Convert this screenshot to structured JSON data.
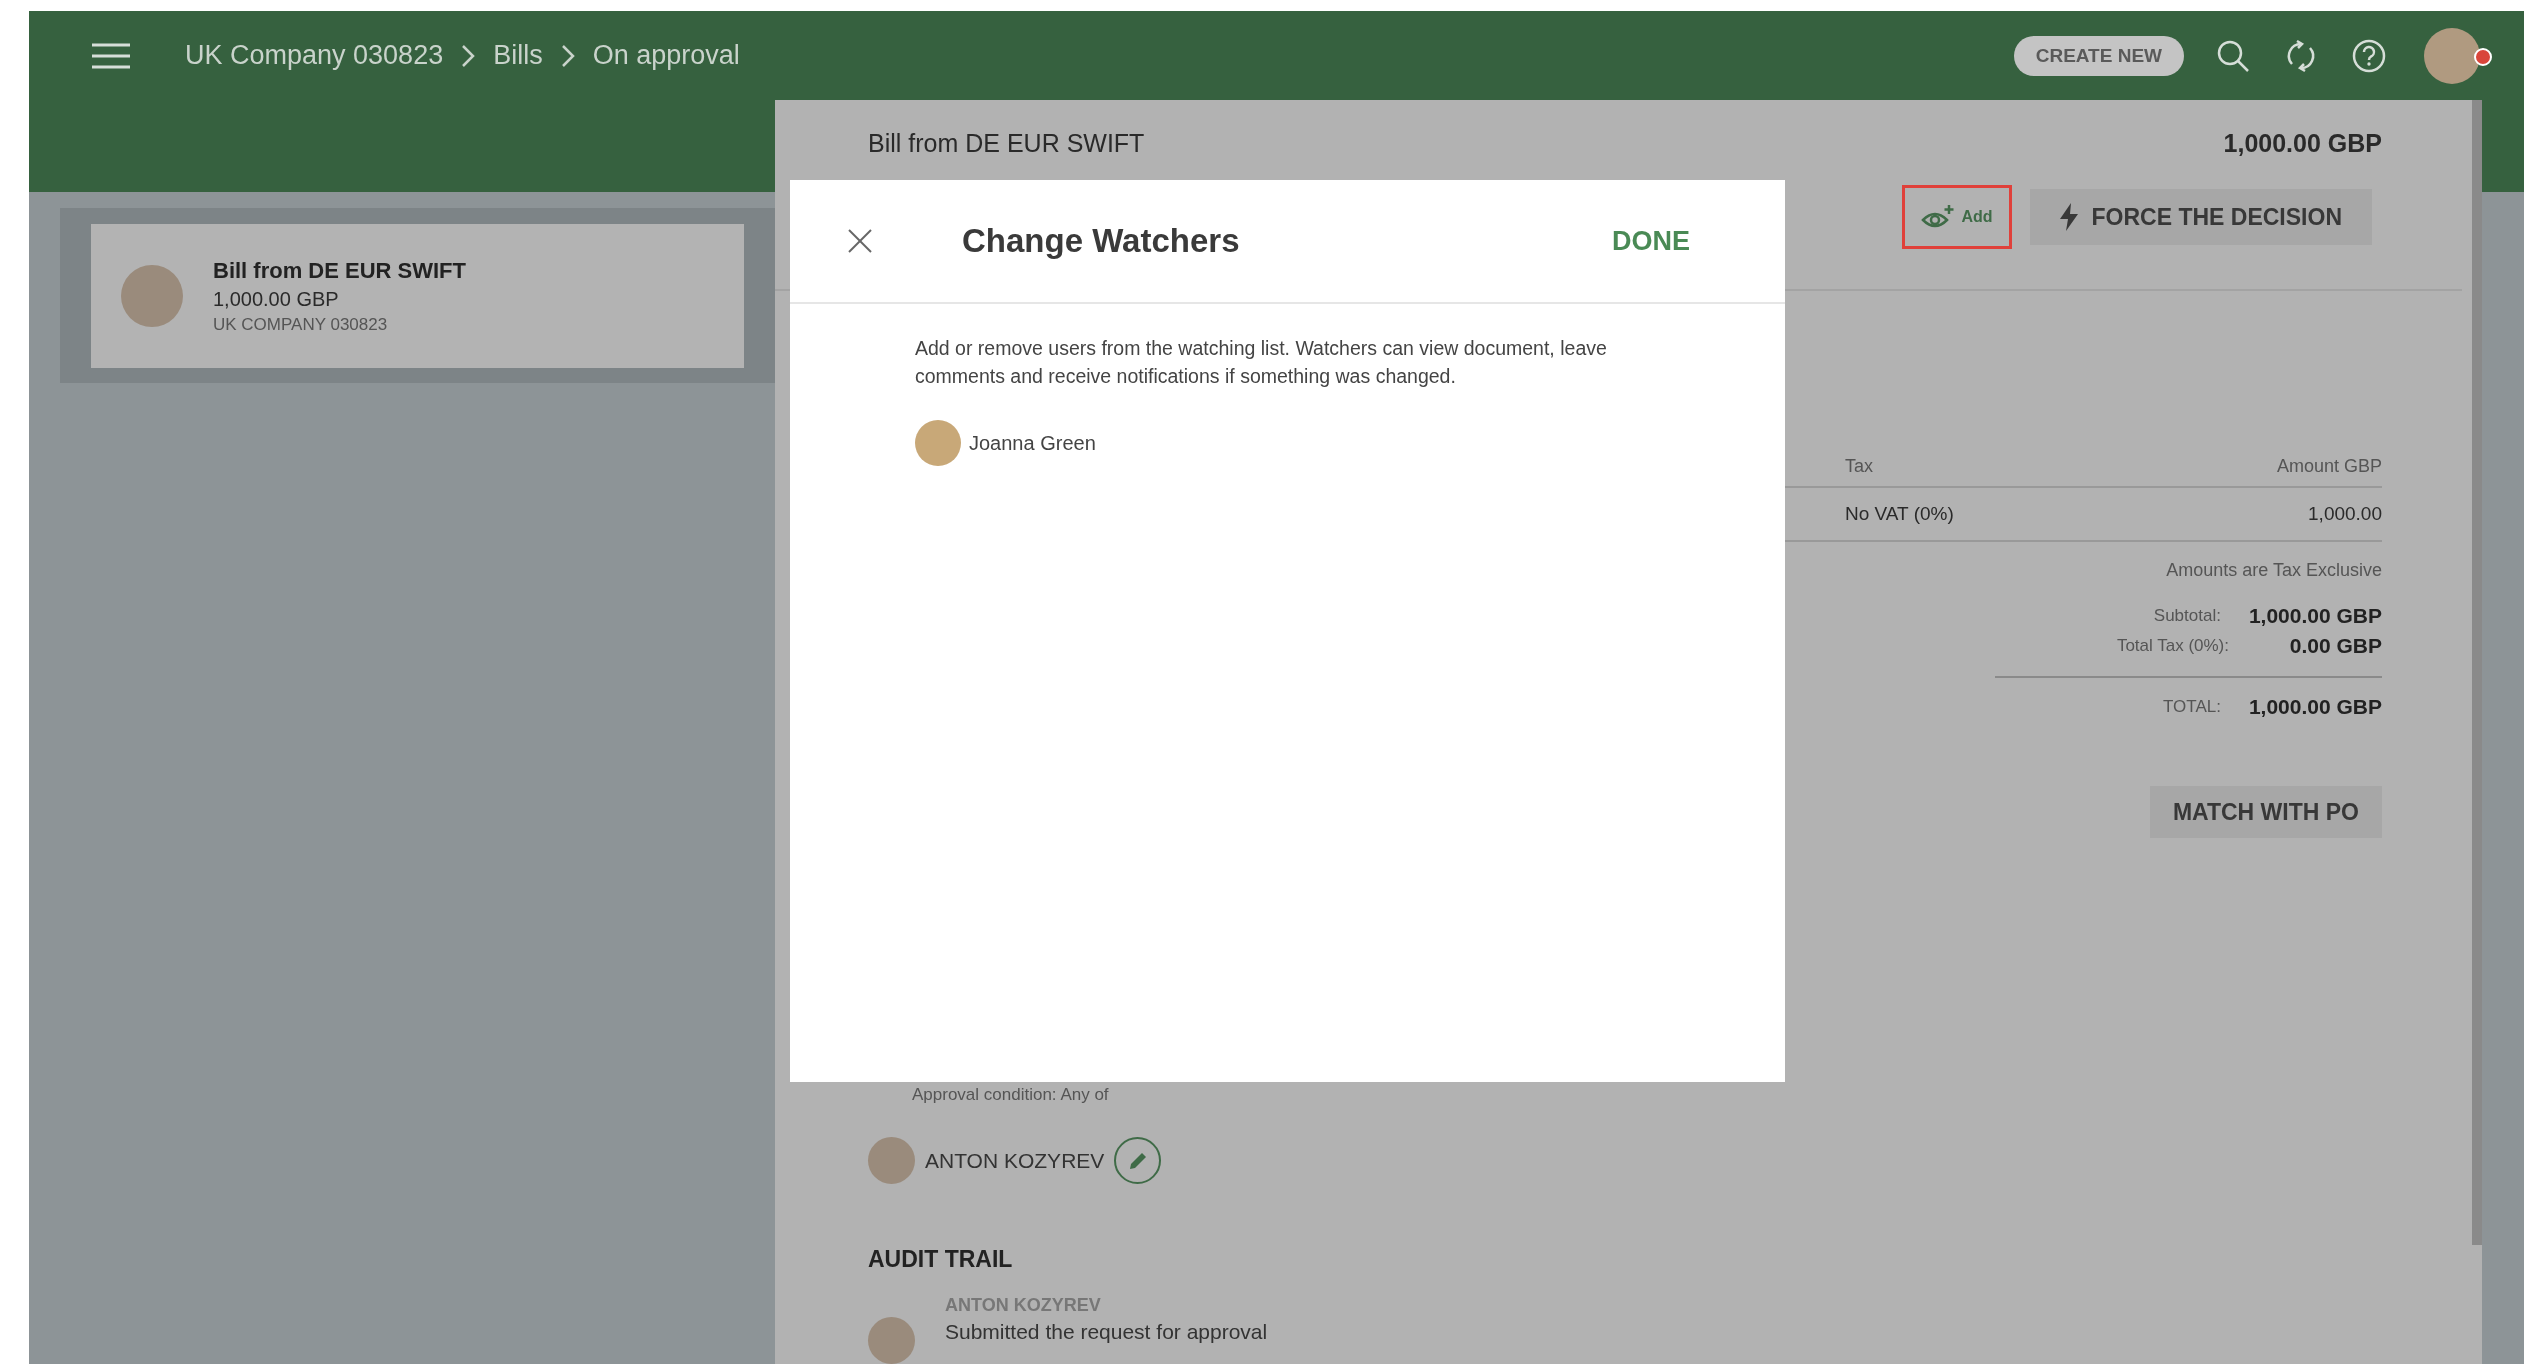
{
  "header": {
    "breadcrumb": [
      "UK Company 030823",
      "Bills",
      "On approval"
    ],
    "create_button": "CREATE NEW"
  },
  "bill_list": [
    {
      "title": "Bill from DE EUR SWIFT",
      "amount": "1,000.00 GBP",
      "company": "UK COMPANY 030823",
      "selected": true
    }
  ],
  "detail": {
    "title": "Bill from DE EUR SWIFT",
    "amount": "1,000.00 GBP",
    "add_watcher_button": {
      "label": "Add",
      "highlighted": true
    },
    "force_button": "FORCE THE DECISION",
    "table": {
      "columns": [
        "Tax",
        "Amount GBP"
      ],
      "rows": [
        [
          "No VAT (0%)",
          "1,000.00"
        ]
      ]
    },
    "tax_note": "Amounts are Tax Exclusive",
    "totals": [
      {
        "label": "Subtotal:",
        "value": "1,000.00 GBP"
      },
      {
        "label": "Total Tax (0%):",
        "value": "0.00 GBP"
      }
    ],
    "total": {
      "label": "TOTAL:",
      "value": "1,000.00 GBP"
    },
    "match_button": "MATCH WITH PO",
    "approval_condition": "Approval condition: Any of",
    "approvers": [
      {
        "name": "ANTON KOZYREV"
      }
    ],
    "audit_title": "AUDIT TRAIL",
    "audit_trail": [
      {
        "user": "ANTON KOZYREV",
        "action": "Submitted the request for approval"
      }
    ]
  },
  "dialog": {
    "title": "Change Watchers",
    "done_button": "DONE",
    "description": "Add or remove users from the watching list. Watchers can view document, leave comments and receive notifications if something was changed.",
    "watchers": [
      {
        "name": "Joanna Green"
      }
    ]
  }
}
